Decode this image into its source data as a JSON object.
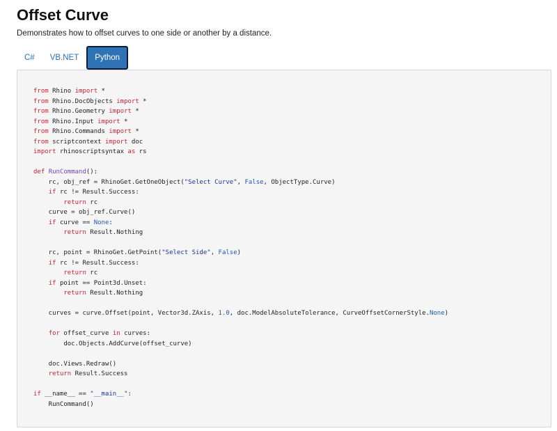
{
  "page": {
    "title": "Offset Curve",
    "subtitle": "Demonstrates how to offset curves to one side or another by a distance."
  },
  "tabs": [
    {
      "label": "C#",
      "active": false
    },
    {
      "label": "VB.NET",
      "active": false
    },
    {
      "label": "Python",
      "active": true
    }
  ],
  "colors": {
    "keyword": "#cc2233",
    "function": "#6f42c1",
    "string": "#183691",
    "literal": "#1c5cb0",
    "active_tab": "#2f73b6",
    "tab_text": "#2a6fb5"
  },
  "code": {
    "language": "Python",
    "lines": [
      [
        {
          "t": "from",
          "c": "kw"
        },
        {
          "t": " Rhino "
        },
        {
          "t": "import",
          "c": "kw"
        },
        {
          "t": " *"
        }
      ],
      [
        {
          "t": "from",
          "c": "kw"
        },
        {
          "t": " Rhino.DocObjects "
        },
        {
          "t": "import",
          "c": "kw"
        },
        {
          "t": " *"
        }
      ],
      [
        {
          "t": "from",
          "c": "kw"
        },
        {
          "t": " Rhino.Geometry "
        },
        {
          "t": "import",
          "c": "kw"
        },
        {
          "t": " *"
        }
      ],
      [
        {
          "t": "from",
          "c": "kw"
        },
        {
          "t": " Rhino.Input "
        },
        {
          "t": "import",
          "c": "kw"
        },
        {
          "t": " *"
        }
      ],
      [
        {
          "t": "from",
          "c": "kw"
        },
        {
          "t": " Rhino.Commands "
        },
        {
          "t": "import",
          "c": "kw"
        },
        {
          "t": " *"
        }
      ],
      [
        {
          "t": "from",
          "c": "kw"
        },
        {
          "t": " scriptcontext "
        },
        {
          "t": "import",
          "c": "kw"
        },
        {
          "t": " doc"
        }
      ],
      [
        {
          "t": "import",
          "c": "kw"
        },
        {
          "t": " rhinoscriptsyntax "
        },
        {
          "t": "as",
          "c": "kw"
        },
        {
          "t": " rs"
        }
      ],
      [],
      [
        {
          "t": "def",
          "c": "kw"
        },
        {
          "t": " "
        },
        {
          "t": "RunCommand",
          "c": "fn"
        },
        {
          "t": "():"
        }
      ],
      [
        {
          "t": "    rc, obj_ref = RhinoGet.GetOneObject("
        },
        {
          "t": "\"Select Curve\"",
          "c": "str"
        },
        {
          "t": ", "
        },
        {
          "t": "False",
          "c": "lit"
        },
        {
          "t": ", ObjectType.Curve)"
        }
      ],
      [
        {
          "t": "    "
        },
        {
          "t": "if",
          "c": "kw"
        },
        {
          "t": " rc != Result.Success:"
        }
      ],
      [
        {
          "t": "        "
        },
        {
          "t": "return",
          "c": "kw"
        },
        {
          "t": " rc"
        }
      ],
      [
        {
          "t": "    curve = obj_ref.Curve()"
        }
      ],
      [
        {
          "t": "    "
        },
        {
          "t": "if",
          "c": "kw"
        },
        {
          "t": " curve == "
        },
        {
          "t": "None",
          "c": "lit"
        },
        {
          "t": ":"
        }
      ],
      [
        {
          "t": "        "
        },
        {
          "t": "return",
          "c": "kw"
        },
        {
          "t": " Result.Nothing"
        }
      ],
      [],
      [
        {
          "t": "    rc, point = RhinoGet.GetPoint("
        },
        {
          "t": "\"Select Side\"",
          "c": "str"
        },
        {
          "t": ", "
        },
        {
          "t": "False",
          "c": "lit"
        },
        {
          "t": ")"
        }
      ],
      [
        {
          "t": "    "
        },
        {
          "t": "if",
          "c": "kw"
        },
        {
          "t": " rc != Result.Success:"
        }
      ],
      [
        {
          "t": "        "
        },
        {
          "t": "return",
          "c": "kw"
        },
        {
          "t": " rc"
        }
      ],
      [
        {
          "t": "    "
        },
        {
          "t": "if",
          "c": "kw"
        },
        {
          "t": " point == Point3d.Unset:"
        }
      ],
      [
        {
          "t": "        "
        },
        {
          "t": "return",
          "c": "kw"
        },
        {
          "t": " Result.Nothing"
        }
      ],
      [],
      [
        {
          "t": "    curves = curve.Offset(point, Vector3d.ZAxis, "
        },
        {
          "t": "1.0",
          "c": "lit"
        },
        {
          "t": ", doc.ModelAbsoluteTolerance, CurveOffsetCornerStyle."
        },
        {
          "t": "None",
          "c": "lit"
        },
        {
          "t": ")"
        }
      ],
      [],
      [
        {
          "t": "    "
        },
        {
          "t": "for",
          "c": "kw"
        },
        {
          "t": " offset_curve "
        },
        {
          "t": "in",
          "c": "kw"
        },
        {
          "t": " curves:"
        }
      ],
      [
        {
          "t": "        doc.Objects.AddCurve(offset_curve)"
        }
      ],
      [],
      [
        {
          "t": "    doc.Views.Redraw()"
        }
      ],
      [
        {
          "t": "    "
        },
        {
          "t": "return",
          "c": "kw"
        },
        {
          "t": " Result.Success"
        }
      ],
      [],
      [
        {
          "t": "if",
          "c": "kw"
        },
        {
          "t": " __name__ == "
        },
        {
          "t": "\"__main__\"",
          "c": "str"
        },
        {
          "t": ":"
        }
      ],
      [
        {
          "t": "    RunCommand()"
        }
      ]
    ]
  }
}
